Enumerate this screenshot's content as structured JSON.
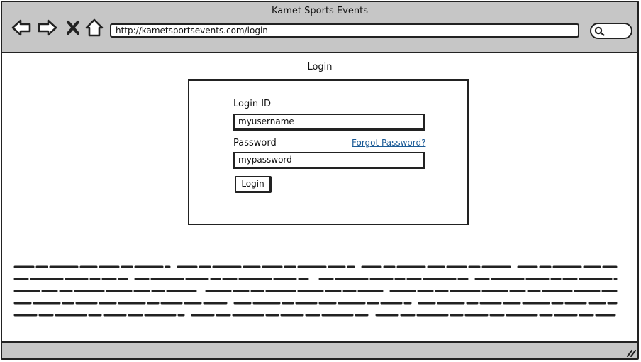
{
  "window": {
    "title": "Kamet Sports Events"
  },
  "toolbar": {
    "icons": [
      "back-arrow-icon",
      "forward-arrow-icon",
      "close-x-icon",
      "home-icon",
      "search-icon"
    ]
  },
  "address_bar": {
    "url": "http://kametsportsevents.com/login"
  },
  "page": {
    "heading": "Login"
  },
  "login_form": {
    "login_id_label": "Login ID",
    "login_id_value": "myusername",
    "password_label": "Password",
    "password_value": "mypassword",
    "forgot_link": "Forgot Password?",
    "submit_label": "Login"
  },
  "colors": {
    "chrome_gray": "#c6c6c6",
    "link_blue": "#1a5a96",
    "stroke": "#222222"
  }
}
